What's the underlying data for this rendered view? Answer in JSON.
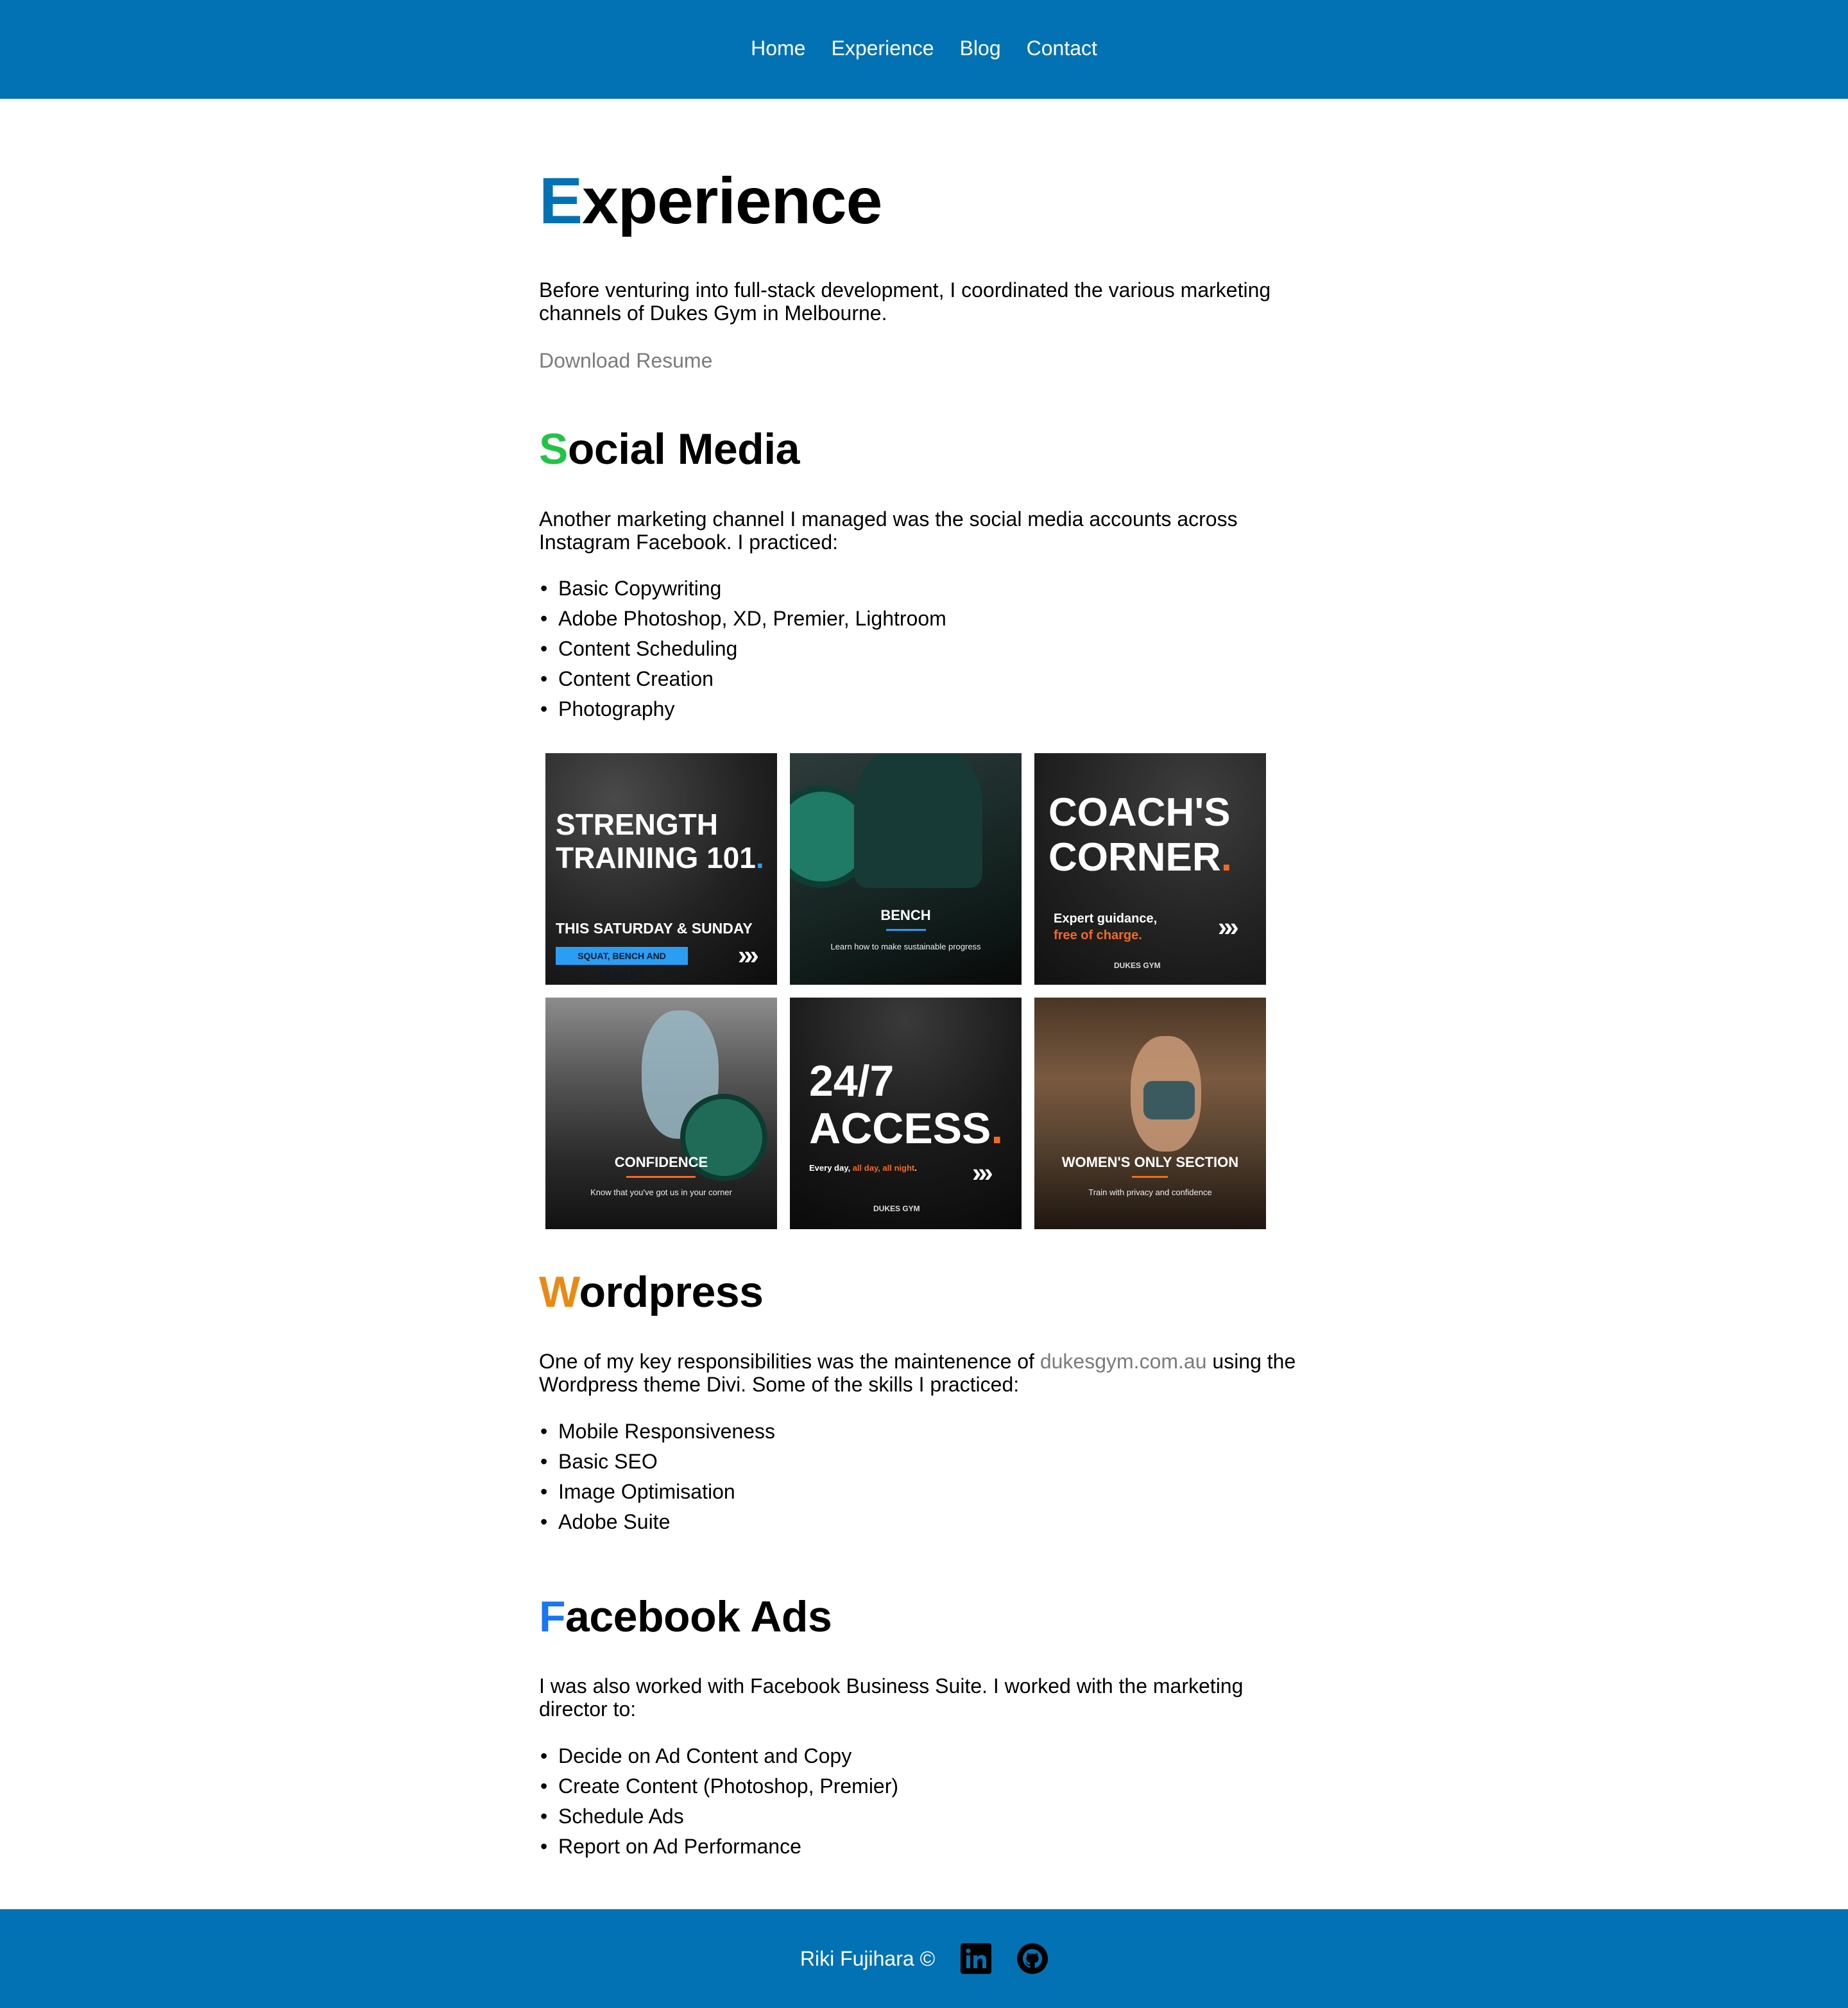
{
  "nav": {
    "items": [
      {
        "label": "Home"
      },
      {
        "label": "Experience"
      },
      {
        "label": "Blog"
      },
      {
        "label": "Contact"
      }
    ]
  },
  "experience": {
    "title_first": "E",
    "title_rest": "xperience",
    "intro": "Before venturing into full-stack development, I coordinated the various marketing channels of Dukes Gym in Melbourne.",
    "download_label": "Download Resume"
  },
  "social": {
    "title_first": "S",
    "title_rest": "ocial Media",
    "intro": "Another marketing channel I managed was the social media accounts across Instagram Facebook. I practiced:",
    "skills": [
      "Basic Copywriting",
      "Adobe Photoshop, XD, Premier, Lightroom",
      "Content Scheduling",
      "Content Creation",
      "Photography"
    ]
  },
  "gallery": [
    {
      "line1": "STRENGTH",
      "line2": "TRAINING 101",
      "accent": ".",
      "sub": "THIS SATURDAY & SUNDAY",
      "tag": "SQUAT, BENCH AND DEADLIFT"
    },
    {
      "label": "BENCH",
      "sub": "Learn how to make sustainable progress"
    },
    {
      "line1": "COACH'S",
      "line2": "CORNER",
      "accent": ".",
      "sub1": "Expert guidance,",
      "sub2": "free of charge.",
      "logo": "DUKES GYM"
    },
    {
      "label": "CONFIDENCE",
      "sub": "Know that you've got us in your corner"
    },
    {
      "line1": "24/7",
      "line2": "ACCESS",
      "accent": ".",
      "sub_a": "Every day, ",
      "sub_b": "all day, all night",
      "sub_c": ".",
      "logo": "DUKES GYM"
    },
    {
      "label": "WOMEN'S ONLY SECTION",
      "sub": "Train with privacy and confidence"
    }
  ],
  "wordpress": {
    "title_first": "W",
    "title_rest": "ordpress",
    "intro_before": "One of my key responsibilities was the maintenence of ",
    "link": "dukesgym.com.au",
    "intro_after": " using the Wordpress theme Divi. Some of the skills I practiced:",
    "skills": [
      "Mobile Responsiveness",
      "Basic SEO",
      "Image Optimisation",
      "Adobe Suite"
    ]
  },
  "facebook": {
    "title_first": "F",
    "title_rest": "acebook Ads",
    "intro": "I was also worked with Facebook Business Suite. I worked with the marketing director to:",
    "skills": [
      "Decide on Ad Content and Copy",
      "Create Content (Photoshop, Premier)",
      "Schedule Ads",
      "Report on Ad Performance"
    ]
  },
  "footer": {
    "name": "Riki Fujihara ©",
    "icons": [
      "linkedin-icon",
      "github-icon"
    ]
  },
  "colors": {
    "brand": "#0272b4",
    "experience_cap": "#0272b4",
    "social_cap": "#22c445",
    "wordpress_cap": "#e98a15",
    "facebook_cap": "#1877f2",
    "muted": "#7b7b7b",
    "accent_blue": "#2a9df4",
    "accent_orange": "#f26a21"
  }
}
